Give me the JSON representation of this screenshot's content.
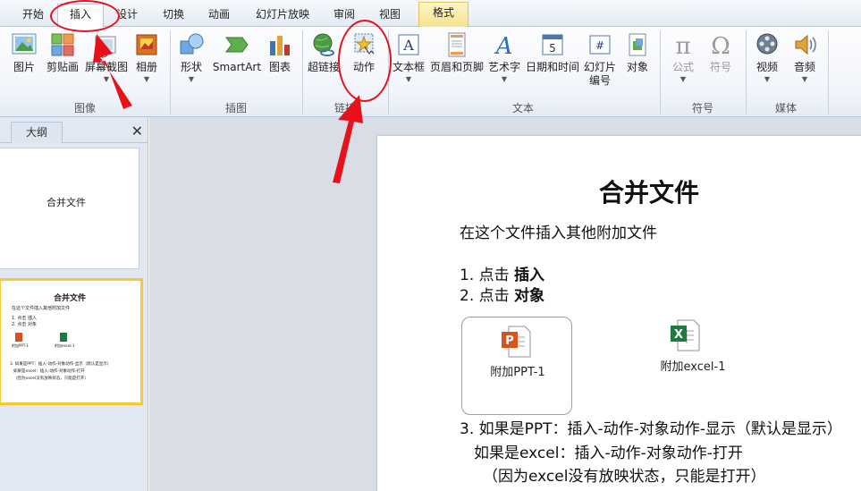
{
  "tabs": [
    {
      "label": "开始"
    },
    {
      "label": "插入"
    },
    {
      "label": "设计"
    },
    {
      "label": "切换"
    },
    {
      "label": "动画"
    },
    {
      "label": "幻灯片放映"
    },
    {
      "label": "审阅"
    },
    {
      "label": "视图"
    },
    {
      "label": "格式"
    }
  ],
  "ribbon": {
    "groups": {
      "images": "图像",
      "illustrations": "插图",
      "links": "链接",
      "text": "文本",
      "symbols": "符号",
      "media": "媒体"
    },
    "buttons": {
      "picture": "图片",
      "clipart": "剪贴画",
      "screenshot": "屏幕截图",
      "album": "相册",
      "shapes": "形状",
      "smartart": "SmartArt",
      "chart": "图表",
      "hyperlink": "超链接",
      "action": "动作",
      "textbox": "文本框",
      "header_footer": "页眉和页脚",
      "wordart": "艺术字",
      "datetime": "日期和时间",
      "slide_number_1": "幻灯片",
      "slide_number_2": "编号",
      "object": "对象",
      "equation": "公式",
      "symbol": "符号",
      "video": "视频",
      "audio": "音频"
    }
  },
  "panel": {
    "tab_outline": "大纲",
    "close": "✕",
    "thumb1_title": "合并文件",
    "thumb2": {
      "title": "合并文件",
      "sub": "在这个文件插入其他附加文件",
      "line1": "1. 点击 插入",
      "line2": "2. 点击 对象",
      "obj1": "附加PPT-1",
      "obj2": "附加excel-1",
      "l3": "3. 如果是PPT：插入-动作-对象动作-显示（默认是显示）",
      "l4": "如果是excel：插入-动作-对象动作-打开",
      "l5": "（因为excel没有放映状态，只能是打开）"
    }
  },
  "slide": {
    "title": "合并文件",
    "subtitle": "在这个文件插入其他附加文件",
    "step1_prefix": "1. 点击",
    "step1_bold": "插入",
    "step2_prefix": "2. 点击",
    "step2_bold": "对象",
    "obj_ppt": "附加PPT-1",
    "obj_excel": "附加excel-1",
    "step3_line1": "3. 如果是PPT：插入-动作-对象动作-显示（默认是显示）",
    "step3_line2": "如果是excel：插入-动作-对象动作-打开",
    "step3_line3": "（因为excel没有放映状态，只能是打开）"
  },
  "colors": {
    "annotation_red": "#e8101a",
    "format_tab": "#f6e28a",
    "selected_thumb": "#f5c93a"
  }
}
